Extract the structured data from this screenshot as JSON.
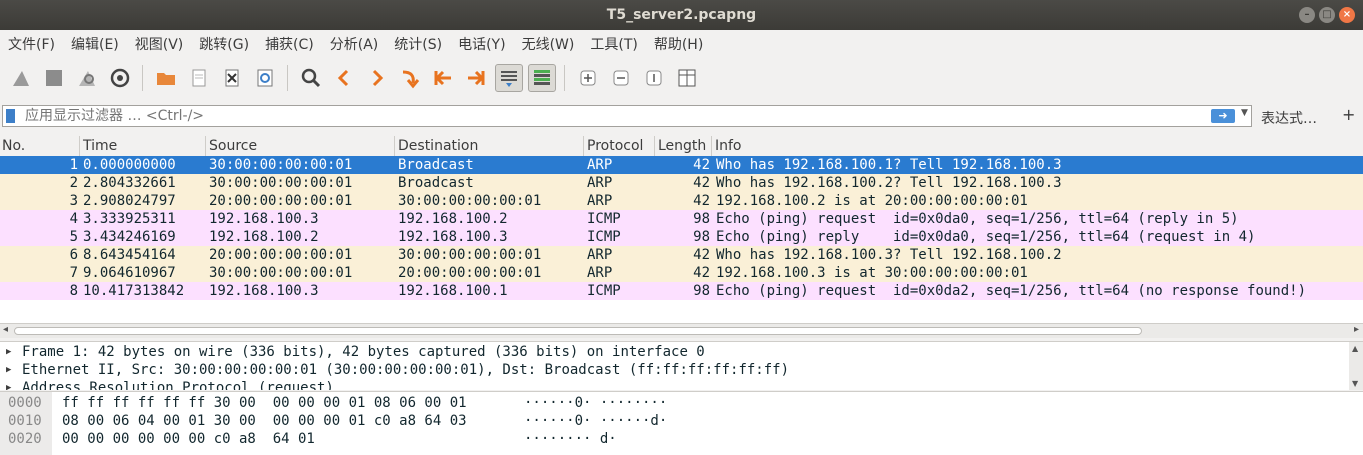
{
  "window": {
    "title": "T5_server2.pcapng"
  },
  "menu": [
    "文件(F)",
    "编辑(E)",
    "视图(V)",
    "跳转(G)",
    "捕获(C)",
    "分析(A)",
    "统计(S)",
    "电话(Y)",
    "无线(W)",
    "工具(T)",
    "帮助(H)"
  ],
  "toolbar": {
    "icons": [
      "shark-fin-icon",
      "stop-icon",
      "restart-icon",
      "capture-options-icon",
      "open-folder-icon",
      "file-icon",
      "close-file-icon",
      "reload-icon",
      "search-icon",
      "back-icon",
      "forward-icon",
      "go-to-packet-icon",
      "first-packet-icon",
      "last-packet-icon",
      "autoscroll-icon",
      "colorize-icon",
      "zoom-in-icon",
      "zoom-out-icon",
      "normal-size-icon",
      "resize-columns-icon"
    ]
  },
  "filter": {
    "placeholder": "应用显示过滤器 … <Ctrl-/>",
    "expression_label": "表达式…",
    "plus_label": "+"
  },
  "columns": [
    "No.",
    "Time",
    "Source",
    "Destination",
    "Protocol",
    "Length",
    "Info"
  ],
  "packets": [
    {
      "no": "1",
      "time": "0.000000000",
      "src": "30:00:00:00:00:01",
      "dst": "Broadcast",
      "proto": "ARP",
      "len": "42",
      "info": "Who has 192.168.100.1? Tell 192.168.100.3",
      "selected": true
    },
    {
      "no": "2",
      "time": "2.804332661",
      "src": "30:00:00:00:00:01",
      "dst": "Broadcast",
      "proto": "ARP",
      "len": "42",
      "info": "Who has 192.168.100.2? Tell 192.168.100.3"
    },
    {
      "no": "3",
      "time": "2.908024797",
      "src": "20:00:00:00:00:01",
      "dst": "30:00:00:00:00:01",
      "proto": "ARP",
      "len": "42",
      "info": "192.168.100.2 is at 20:00:00:00:00:01"
    },
    {
      "no": "4",
      "time": "3.333925311",
      "src": "192.168.100.3",
      "dst": "192.168.100.2",
      "proto": "ICMP",
      "len": "98",
      "info": "Echo (ping) request  id=0x0da0, seq=1/256, ttl=64 (reply in 5)"
    },
    {
      "no": "5",
      "time": "3.434246169",
      "src": "192.168.100.2",
      "dst": "192.168.100.3",
      "proto": "ICMP",
      "len": "98",
      "info": "Echo (ping) reply    id=0x0da0, seq=1/256, ttl=64 (request in 4)"
    },
    {
      "no": "6",
      "time": "8.643454164",
      "src": "20:00:00:00:00:01",
      "dst": "30:00:00:00:00:01",
      "proto": "ARP",
      "len": "42",
      "info": "Who has 192.168.100.3? Tell 192.168.100.2"
    },
    {
      "no": "7",
      "time": "9.064610967",
      "src": "30:00:00:00:00:01",
      "dst": "20:00:00:00:00:01",
      "proto": "ARP",
      "len": "42",
      "info": "192.168.100.3 is at 30:00:00:00:00:01"
    },
    {
      "no": "8",
      "time": "10.417313842",
      "src": "192.168.100.3",
      "dst": "192.168.100.1",
      "proto": "ICMP",
      "len": "98",
      "info": "Echo (ping) request  id=0x0da2, seq=1/256, ttl=64 (no response found!)"
    }
  ],
  "details": [
    "Frame 1: 42 bytes on wire (336 bits), 42 bytes captured (336 bits) on interface 0",
    "Ethernet II, Src: 30:00:00:00:00:01 (30:00:00:00:00:01), Dst: Broadcast (ff:ff:ff:ff:ff:ff)",
    "Address Resolution Protocol (request)"
  ],
  "bytes": [
    {
      "offset": "0000",
      "hex": "ff ff ff ff ff ff 30 00  00 00 00 01 08 06 00 01",
      "ascii": "······0· ········"
    },
    {
      "offset": "0010",
      "hex": "08 00 06 04 00 01 30 00  00 00 00 01 c0 a8 64 03",
      "ascii": "······0· ······d·"
    },
    {
      "offset": "0020",
      "hex": "00 00 00 00 00 00 c0 a8  64 01",
      "ascii": "········ d·"
    }
  ],
  "colors": {
    "arp_row": "#faf0d7",
    "icmp_row": "#fce0ff",
    "selected_row": "#2a7bd0",
    "titlebar": "#3c3b37",
    "close_button": "#f07746"
  }
}
